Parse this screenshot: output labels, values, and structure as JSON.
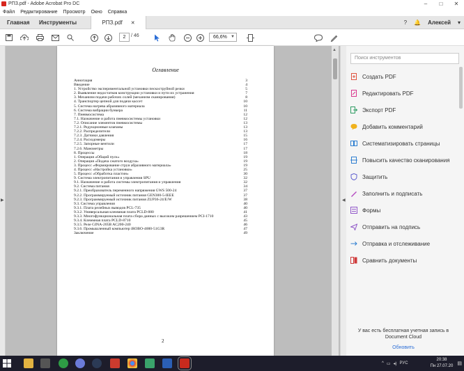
{
  "window": {
    "title": "РПЗ.pdf - Adobe Acrobat Pro DC"
  },
  "menu": [
    "Файл",
    "Редактирование",
    "Просмотр",
    "Окно",
    "Справка"
  ],
  "tabs": {
    "home": "Главная",
    "tools": "Инструменты",
    "document": "РПЗ.pdf"
  },
  "user": {
    "name": "Алексей"
  },
  "toolbar": {
    "page_current": "2",
    "page_total": "/ 46",
    "zoom": "66,6%"
  },
  "document": {
    "heading": "Оглавление",
    "page_number": "2",
    "toc": [
      {
        "t": "Аннотация",
        "p": "3"
      },
      {
        "t": "Введение",
        "p": "4"
      },
      {
        "t": "1. Устройство экспериментальной установки пескоструйной резки",
        "p": "5"
      },
      {
        "t": "2. Выявление недостатков конструкции установки и пути их устранения",
        "p": "7"
      },
      {
        "t": "3. Механизм подачи рабочих солей (механизм сканирования)",
        "p": "8"
      },
      {
        "t": "4. Транспортер цепной для подачи кассет",
        "p": "10"
      },
      {
        "t": "5. Система нагрева абразивного материала",
        "p": "10"
      },
      {
        "t": "6. Система вибрации бункера",
        "p": "11"
      },
      {
        "t": "7. Пневмосистема",
        "p": "12"
      },
      {
        "t": "7.1. Назначение и работа пневмосистемы установки",
        "p": "12"
      },
      {
        "t": "7.2. Описание элементов пневмосистемы",
        "p": "13"
      },
      {
        "t": "7.2.1. Редукционные клапаны",
        "p": "13"
      },
      {
        "t": "7.2.2. Распределители",
        "p": "13"
      },
      {
        "t": "7.2.3. Датчики давления",
        "p": "15"
      },
      {
        "t": "7.2.4. Расходомеры",
        "p": "16"
      },
      {
        "t": "7.2.5. Запорные вентили",
        "p": "17"
      },
      {
        "t": "7.2.6. Манометры",
        "p": "17"
      },
      {
        "t": "8. Процессы",
        "p": "18"
      },
      {
        "t": "1. Операция «Общий пуск»",
        "p": "19"
      },
      {
        "t": "2. Операция «Подача сжатого воздуха»",
        "p": "19"
      },
      {
        "t": "3. Процесс «Формирование струи абразивного материала»",
        "p": "19"
      },
      {
        "t": "4. Процесс «Настройка установки»",
        "p": "25"
      },
      {
        "t": "5. Процесс «Обработка пластин»",
        "p": "30"
      },
      {
        "t": "9. Система электропитания и управления SPU",
        "p": "32"
      },
      {
        "t": "9.1. Назначение и работа системы электропитания и управления",
        "p": "32"
      },
      {
        "t": "9.2. Система питания",
        "p": "34"
      },
      {
        "t": "9.2.1. Преобразователь переменного напряжения GWS 500-24",
        "p": "37"
      },
      {
        "t": "9.2.2. Программируемый источник питания GEN300-5-IEEE",
        "p": "37"
      },
      {
        "t": "9.2.3. Программируемый источник питания ZUP36-24/E/W",
        "p": "38"
      },
      {
        "t": "9.3. Система управления",
        "p": "40"
      },
      {
        "t": "9.3.1. Плата релейных выводов PCL-735",
        "p": "40"
      },
      {
        "t": "9.3.2. Универсальная клеммная плата PCLD-880",
        "p": "41"
      },
      {
        "t": "9.3.3. Многофункциональная плата сбора данных с высоким разрешением PCI-1710",
        "p": "43"
      },
      {
        "t": "9.3.4. Клеммная плата PCLD-8710",
        "p": "45"
      },
      {
        "t": "9.3.5. Реле GINA-205B AC200-240",
        "p": "46"
      },
      {
        "t": "9.3.6. Промышленный компьютер iROBO-4000-51G3R",
        "p": "47"
      },
      {
        "t": "Заключение",
        "p": "49"
      }
    ]
  },
  "tools_panel": {
    "search_placeholder": "Поиск инструментов",
    "items": [
      {
        "label": "Создать PDF",
        "icon": "create-pdf-icon",
        "color": "#e0533f"
      },
      {
        "label": "Редактировать PDF",
        "icon": "edit-pdf-icon",
        "color": "#d9368d"
      },
      {
        "label": "Экспорт PDF",
        "icon": "export-pdf-icon",
        "color": "#2e9c62"
      },
      {
        "label": "Добавить комментарий",
        "icon": "comment-icon",
        "color": "#f0b21c"
      },
      {
        "label": "Систематизировать страницы",
        "icon": "organize-pages-icon",
        "color": "#2f7fd1"
      },
      {
        "label": "Повысить качество сканирования",
        "icon": "enhance-scan-icon",
        "color": "#2f7fd1"
      },
      {
        "label": "Защитить",
        "icon": "protect-icon",
        "color": "#5f5fcf"
      },
      {
        "label": "Заполнить и подписать",
        "icon": "fill-sign-icon",
        "color": "#b54cc2"
      },
      {
        "label": "Формы",
        "icon": "forms-icon",
        "color": "#9157c9"
      },
      {
        "label": "Отправить на подпись",
        "icon": "send-sign-icon",
        "color": "#8e55c7"
      },
      {
        "label": "Отправка и отслеживание",
        "icon": "send-track-icon",
        "color": "#2f7fd1"
      },
      {
        "label": "Сравнить документы",
        "icon": "compare-icon",
        "color": "#cf3a3a"
      }
    ],
    "promo_text": "У вас есть бесплатная учетная запись в Document Cloud",
    "promo_link": "Обновить"
  },
  "taskbar": {
    "lang": "РУС",
    "time": "20:38",
    "date": "Пн 27.07.20"
  }
}
